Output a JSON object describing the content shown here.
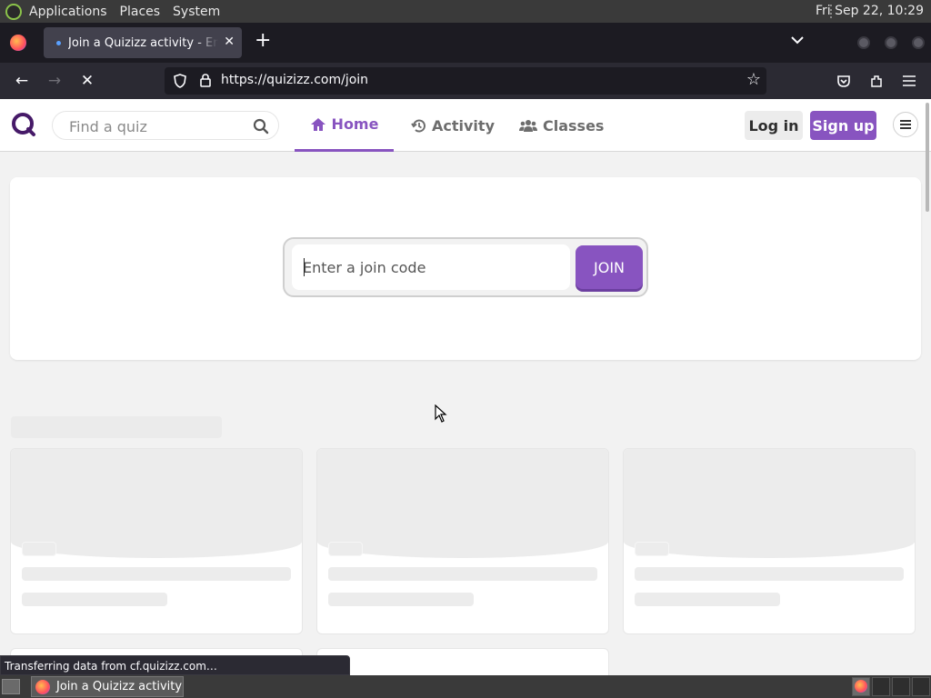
{
  "top_panel": {
    "menus": [
      "Applications",
      "Places",
      "System"
    ],
    "clock": "Fri Sep 22, 10:29"
  },
  "browser": {
    "tab_title": "Join a Quizizz activity - Enter code",
    "url": "https://quizizz.com/join"
  },
  "site_header": {
    "search_placeholder": "Find a quiz",
    "nav": [
      {
        "label": "Home",
        "icon": "home-icon",
        "active": true
      },
      {
        "label": "Activity",
        "icon": "history-icon",
        "active": false
      },
      {
        "label": "Classes",
        "icon": "users-icon",
        "active": false
      }
    ],
    "login_label": "Log in",
    "signup_label": "Sign up"
  },
  "join": {
    "placeholder": "Enter a join code",
    "button_label": "JOIN"
  },
  "status_bar": {
    "text": "Transferring data from cf.quizizz.com…"
  },
  "taskbar": {
    "task_label": "Join a Quizizz activity…"
  },
  "colors": {
    "brand_purple": "#8854c0",
    "page_bg": "#f2f2f2",
    "firefox_chrome": "#2b2a33"
  }
}
